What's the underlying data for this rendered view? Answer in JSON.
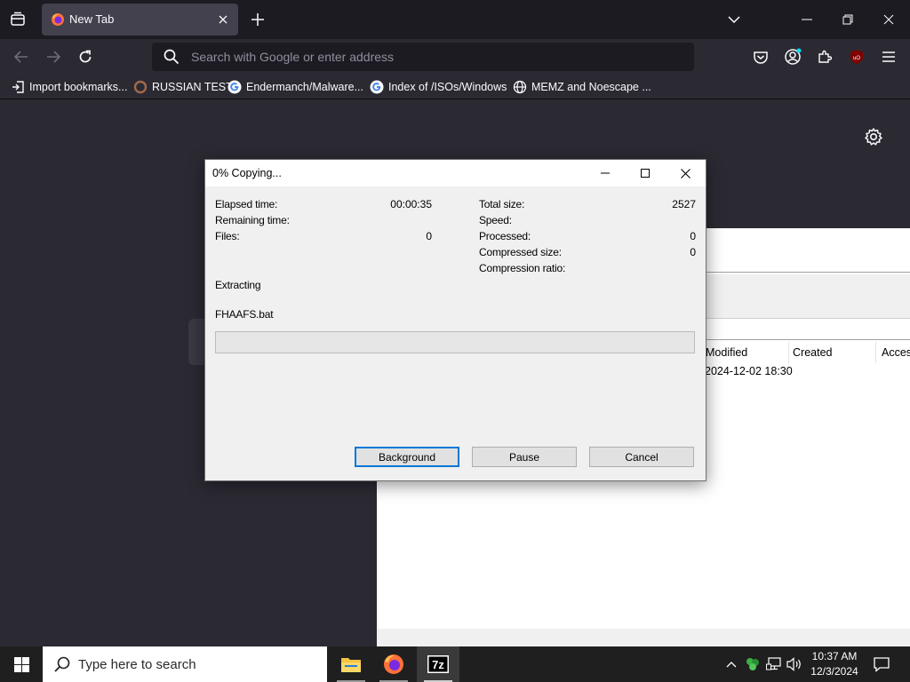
{
  "browser": {
    "tab": {
      "title": "New Tab"
    },
    "urlbar": {
      "placeholder": "Search with Google or enter address"
    },
    "bookmarks": [
      {
        "label": "Import bookmarks...",
        "icon": "import-icon"
      },
      {
        "label": "RUSSIAN TEST",
        "icon": "site-favicon"
      },
      {
        "label": "Endermanch/Malware...",
        "icon": "google-g-icon"
      },
      {
        "label": "Index of /ISOs/Windows",
        "icon": "google-g-icon"
      },
      {
        "label": "MEMZ and Noescape ...",
        "icon": "globe-icon"
      }
    ]
  },
  "zip_window": {
    "columns": [
      "Modified",
      "Created",
      "Acces"
    ],
    "row": {
      "modified": "2024-12-02 18:30"
    }
  },
  "dialog": {
    "title": "0% Copying...",
    "left": {
      "elapsed_label": "Elapsed time:",
      "elapsed_value": "00:00:35",
      "remaining_label": "Remaining time:",
      "files_label": "Files:",
      "files_value": "0"
    },
    "right": {
      "total_label": "Total size:",
      "total_value": "2527",
      "speed_label": "Speed:",
      "processed_label": "Processed:",
      "processed_value": "0",
      "compressed_label": "Compressed size:",
      "compressed_value": "0",
      "ratio_label": "Compression ratio:"
    },
    "operation": "Extracting",
    "file": "FHAAFS.bat",
    "progress_percent": 0,
    "buttons": {
      "background": "Background",
      "pause": "Pause",
      "cancel": "Cancel"
    }
  },
  "taskbar": {
    "search_placeholder": "Type here to search",
    "time": "10:37 AM",
    "date": "12/3/2024"
  },
  "colors": {
    "chrome_dark": "#1c1b22",
    "chrome": "#2b2a33",
    "accent": "#0078d7",
    "progress_fill": "#06b025"
  }
}
